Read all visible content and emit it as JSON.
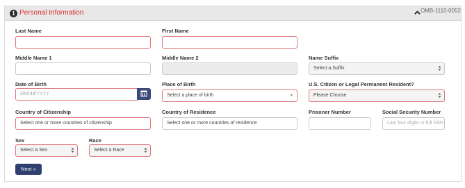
{
  "header": {
    "step_number": "1",
    "title": "Personal Information",
    "omb": "OMB-1110-0052"
  },
  "fields": {
    "last_name": {
      "label": "Last Name",
      "value": ""
    },
    "first_name": {
      "label": "First Name",
      "value": ""
    },
    "middle_name_1": {
      "label": "Middle Name 1",
      "value": ""
    },
    "middle_name_2": {
      "label": "Middle Name 2",
      "value": ""
    },
    "name_suffix": {
      "label": "Name Suffix",
      "value": "Select a Suffix"
    },
    "dob": {
      "label": "Date of Birth",
      "placeholder": "MM/dd/YYYY"
    },
    "place_of_birth": {
      "label": "Place of Birth",
      "value": "Select a place of birth"
    },
    "citizen": {
      "label": "U.S. Citizen or Legal Permanent Resident?",
      "value": "Please Choose"
    },
    "country_citizenship": {
      "label": "Country of Citizenship",
      "value": "Select one or more countries of citizenship"
    },
    "country_residence": {
      "label": "Country of Residence",
      "value": "Select one or more countries of residence"
    },
    "prisoner_number": {
      "label": "Prisoner Number",
      "value": ""
    },
    "ssn": {
      "label": "Social Security Number",
      "placeholder": "Last four digits or full SSN"
    },
    "sex": {
      "label": "Sex",
      "value": "Select a Sex"
    },
    "race": {
      "label": "Race",
      "value": "Select a Race"
    }
  },
  "actions": {
    "next_label": "Next »"
  },
  "icons": {
    "calendar": "calendar-icon",
    "collapse": "caret-up-icon",
    "select_arrows": "updown-arrows-icon"
  },
  "colors": {
    "accent_red": "#d9302c",
    "error_border": "#e0787a",
    "button_navy": "#2e3f70"
  }
}
